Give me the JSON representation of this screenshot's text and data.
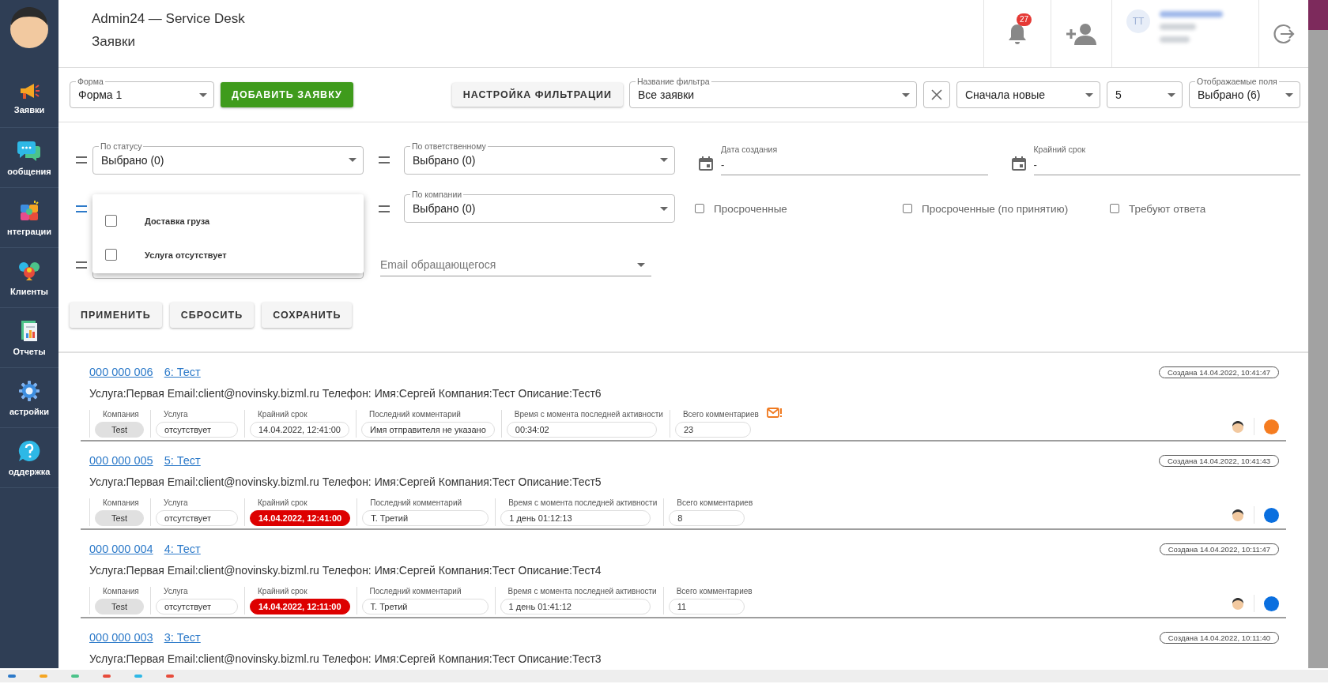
{
  "header": {
    "title": "Admin24 — Service Desk",
    "subtitle": "Заявки",
    "notification_count": "27",
    "user_initials": "TT"
  },
  "sidebar": {
    "items": [
      {
        "label": "Заявки"
      },
      {
        "label": "ообщения"
      },
      {
        "label": "нтеграции"
      },
      {
        "label": "Клиенты"
      },
      {
        "label": "Отчеты"
      },
      {
        "label": "астройки"
      },
      {
        "label": "оддержка"
      }
    ]
  },
  "toolbar": {
    "form": {
      "label": "Форма",
      "value": "Форма 1"
    },
    "add_button": "ДОБАВИТЬ ЗАЯВКУ",
    "filter_settings_button": "НАСТРОЙКА ФИЛЬТРАЦИИ",
    "filter_name": {
      "label": "Название фильтра",
      "value": "Все заявки"
    },
    "sort": {
      "value": "Сначала новые"
    },
    "page_size": {
      "value": "5"
    },
    "shown_fields": {
      "label": "Отображаемые поля",
      "value": "Выбрано (6)"
    }
  },
  "filters": {
    "status": {
      "label": "По статусу",
      "value": "Выбрано (0)",
      "active": false
    },
    "responsible": {
      "label": "По ответственному",
      "value": "Выбрано (0)",
      "active": false
    },
    "created": {
      "label": "Дата создания",
      "value": "-"
    },
    "deadline": {
      "label": "Крайний срок",
      "value": "-"
    },
    "service": {
      "active": true,
      "expanded": true,
      "options": [
        {
          "label": "Доставка груза",
          "checked": false
        },
        {
          "label": "Услуга отсутствует",
          "checked": false
        }
      ]
    },
    "company": {
      "label": "По компании",
      "value": "Выбрано (0)",
      "active": false
    },
    "checkboxes": [
      {
        "label": "Просроченные",
        "checked": false
      },
      {
        "label": "Просроченные (по принятию)",
        "checked": false
      },
      {
        "label": "Требуют ответа",
        "checked": false
      }
    ],
    "hidden_field": {
      "active": false
    },
    "email": {
      "placeholder": "Email обращающегося"
    },
    "buttons": [
      "ПРИМЕНИТЬ",
      "СБРОСИТЬ",
      "СОХРАНИТЬ"
    ]
  },
  "tickets": [
    {
      "number": "000 000 006",
      "title": "6: Тест",
      "created": "Создана 14.04.2022, 10:41:47",
      "description": "Услуга:Первая Email:client@novinsky.bizml.ru Телефон: Имя:Сергей Компания:Тест Описание:Тест6",
      "unread_mail": true,
      "color": "#f57c20",
      "fields": [
        {
          "label": "Компания",
          "value": "Test",
          "kind": "tag"
        },
        {
          "label": "Услуга",
          "value": "отсутствует",
          "kind": "pill"
        },
        {
          "label": "Крайний срок",
          "value": "14.04.2022, 12:41:00",
          "kind": "pill"
        },
        {
          "label": "Последний комментарий",
          "value": "Имя отправителя не указано",
          "kind": "pill"
        },
        {
          "label": "Время с момента последней активности",
          "value": "00:34:02",
          "kind": "pill"
        },
        {
          "label": "Всего комментариев",
          "value": "23",
          "kind": "pill"
        }
      ]
    },
    {
      "number": "000 000 005",
      "title": "5: Тест",
      "created": "Создана 14.04.2022, 10:41:43",
      "description": "Услуга:Первая Email:client@novinsky.bizml.ru Телефон: Имя:Сергей Компания:Тест Описание:Тест5",
      "color": "#0a6fdf",
      "fields": [
        {
          "label": "Компания",
          "value": "Test",
          "kind": "tag"
        },
        {
          "label": "Услуга",
          "value": "отсутствует",
          "kind": "pill"
        },
        {
          "label": "Крайний срок",
          "value": "14.04.2022, 12:41:00",
          "kind": "overdue"
        },
        {
          "label": "Последний комментарий",
          "value": "Т. Третий",
          "kind": "pill"
        },
        {
          "label": "Время с момента последней активности",
          "value": "1 день 01:12:13",
          "kind": "pill"
        },
        {
          "label": "Всего комментариев",
          "value": "8",
          "kind": "pill"
        }
      ]
    },
    {
      "number": "000 000 004",
      "title": "4: Тест",
      "created": "Создана 14.04.2022, 10:11:47",
      "description": "Услуга:Первая Email:client@novinsky.bizml.ru Телефон: Имя:Сергей Компания:Тест Описание:Тест4",
      "color": "#0a6fdf",
      "fields": [
        {
          "label": "Компания",
          "value": "Test",
          "kind": "tag"
        },
        {
          "label": "Услуга",
          "value": "отсутствует",
          "kind": "pill"
        },
        {
          "label": "Крайний срок",
          "value": "14.04.2022, 12:11:00",
          "kind": "overdue"
        },
        {
          "label": "Последний комментарий",
          "value": "Т. Третий",
          "kind": "pill"
        },
        {
          "label": "Время с момента последней активности",
          "value": "1 день 01:41:12",
          "kind": "pill"
        },
        {
          "label": "Всего комментариев",
          "value": "11",
          "kind": "pill"
        }
      ]
    },
    {
      "number": "000 000 003",
      "title": "3: Тест",
      "created": "Создана 14.04.2022, 10:11:40",
      "description": "Услуга:Первая Email:client@novinsky.bizml.ru Телефон: Имя:Сергей Компания:Тест Описание:Тест3"
    }
  ]
}
